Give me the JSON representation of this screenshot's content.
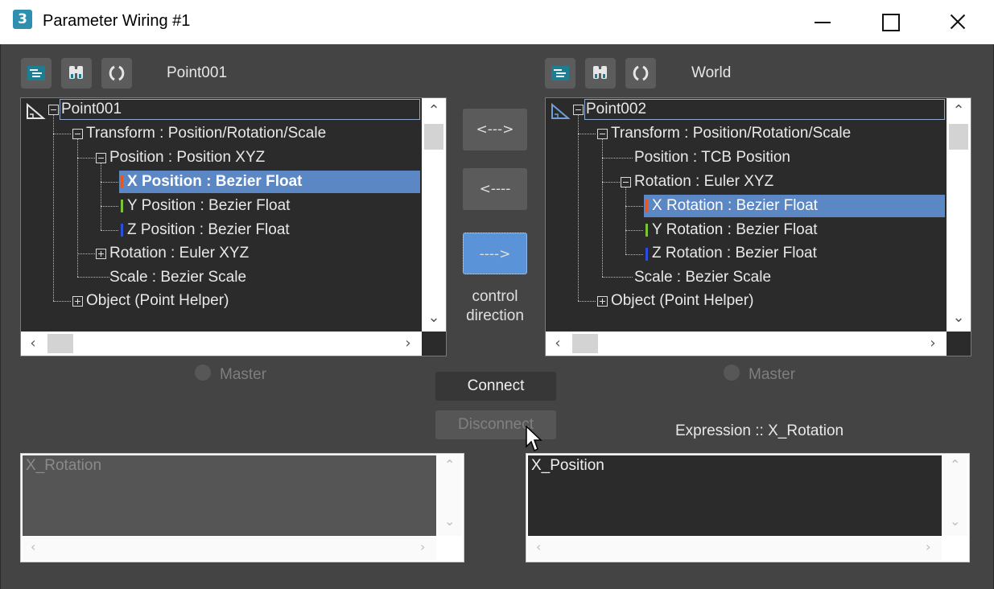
{
  "window": {
    "app_icon": "3",
    "title": "Parameter Wiring #1"
  },
  "left": {
    "header_label": "Point001",
    "toolbar_icons": [
      "track-view-icon",
      "find-icon",
      "refresh-icon"
    ],
    "tree": {
      "root_label": "Point001",
      "rows": [
        "Transform : Position/Rotation/Scale",
        "Position : Position XYZ",
        "X Position : Bezier Float",
        "Y Position : Bezier Float",
        "Z Position : Bezier Float",
        "Rotation : Euler XYZ",
        "Scale : Bezier Scale",
        "Object (Point Helper)"
      ],
      "selected": "X Position : Bezier Float"
    },
    "master_label": "Master",
    "expression_text": "X_Rotation"
  },
  "right": {
    "header_label": "World",
    "toolbar_icons": [
      "track-view-icon",
      "find-icon",
      "refresh-icon"
    ],
    "tree": {
      "root_label": "Point002",
      "rows": [
        "Transform : Position/Rotation/Scale",
        "Position : TCB Position",
        "Rotation : Euler XYZ",
        "X Rotation : Bezier Float",
        "Y Rotation : Bezier Float",
        "Z Rotation : Bezier Float",
        "Scale : Bezier Scale",
        "Object (Point Helper)"
      ],
      "selected": "X Rotation : Bezier Float"
    },
    "master_label": "Master",
    "expression_label": "Expression :: X_Rotation",
    "expression_text": "X_Position"
  },
  "center": {
    "two_way_label": "<--->",
    "left_label": "<----",
    "right_label": "---->",
    "direction_caption_line1": "control",
    "direction_caption_line2": "direction",
    "connect_label": "Connect",
    "disconnect_label": "Disconnect"
  },
  "colors": {
    "selection": "#5b87c5",
    "active_button": "#5b93d8",
    "axis_x": "#e05a28",
    "axis_y": "#7cc23a",
    "axis_z": "#2b4de0"
  }
}
